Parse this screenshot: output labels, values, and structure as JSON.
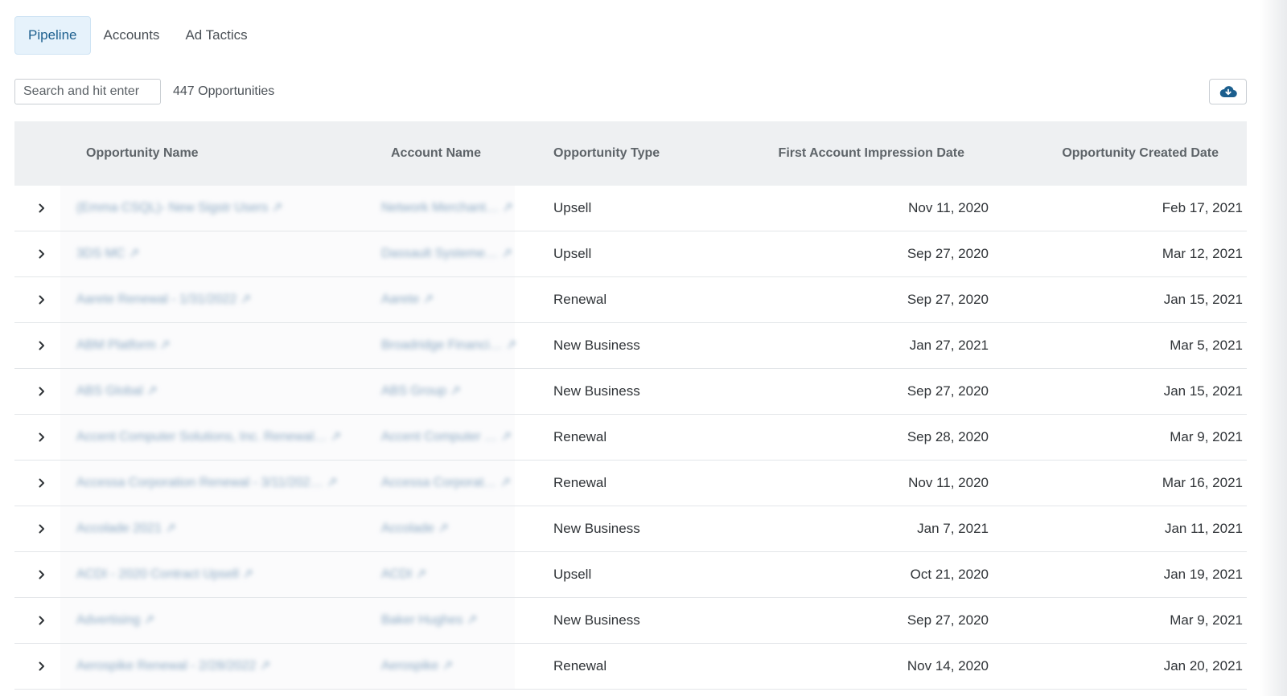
{
  "tabs": [
    {
      "label": "Pipeline",
      "active": true
    },
    {
      "label": "Accounts",
      "active": false
    },
    {
      "label": "Ad Tactics",
      "active": false
    }
  ],
  "search": {
    "placeholder": "Search and hit enter"
  },
  "count_label": "447 Opportunities",
  "colors": {
    "accent": "#1c5f8e",
    "tab_active_bg": "#e6f2fb",
    "header_bg": "#eef0f2"
  },
  "icons": {
    "download": "cloud-download-icon",
    "expand": "chevron-right-icon",
    "external": "external-link-icon"
  },
  "table": {
    "headers": {
      "opportunity_name": "Opportunity Name",
      "account_name": "Account Name",
      "opportunity_type": "Opportunity Type",
      "first_impression": "First Account Impression Date",
      "created": "Opportunity Created Date"
    },
    "rows": [
      {
        "opp": "(Emma CSQL)- New Sigstr Users",
        "acct": "Network Merchant…",
        "type": "Upsell",
        "first": "Nov 11, 2020",
        "created": "Feb 17, 2021"
      },
      {
        "opp": "3DS MC",
        "acct": "Dassault Systeme…",
        "type": "Upsell",
        "first": "Sep 27, 2020",
        "created": "Mar 12, 2021"
      },
      {
        "opp": "Aarete Renewal - 1/31/2022",
        "acct": "Aarete",
        "type": "Renewal",
        "first": "Sep 27, 2020",
        "created": "Jan 15, 2021"
      },
      {
        "opp": "ABM Platform",
        "acct": "Broadridge Financi…",
        "type": "New Business",
        "first": "Jan 27, 2021",
        "created": "Mar 5, 2021"
      },
      {
        "opp": "ABS Global",
        "acct": "ABS Group",
        "type": "New Business",
        "first": "Sep 27, 2020",
        "created": "Jan 15, 2021"
      },
      {
        "opp": "Accent Computer Solutions, Inc. Renewal…",
        "acct": "Accent Computer …",
        "type": "Renewal",
        "first": "Sep 28, 2020",
        "created": "Mar 9, 2021"
      },
      {
        "opp": "Accessa Corporation Renewal - 3/11/202…",
        "acct": "Accessa Corporat…",
        "type": "Renewal",
        "first": "Nov 11, 2020",
        "created": "Mar 16, 2021"
      },
      {
        "opp": "Accolade 2021",
        "acct": "Accolade",
        "type": "New Business",
        "first": "Jan 7, 2021",
        "created": "Jan 11, 2021"
      },
      {
        "opp": "ACDI - 2020 Contract Upsell",
        "acct": "ACDI",
        "type": "Upsell",
        "first": "Oct 21, 2020",
        "created": "Jan 19, 2021"
      },
      {
        "opp": "Advertising",
        "acct": "Baker Hughes",
        "type": "New Business",
        "first": "Sep 27, 2020",
        "created": "Mar 9, 2021"
      },
      {
        "opp": "Aerospike Renewal - 2/28/2022",
        "acct": "Aerospike",
        "type": "Renewal",
        "first": "Nov 14, 2020",
        "created": "Jan 20, 2021"
      }
    ]
  }
}
